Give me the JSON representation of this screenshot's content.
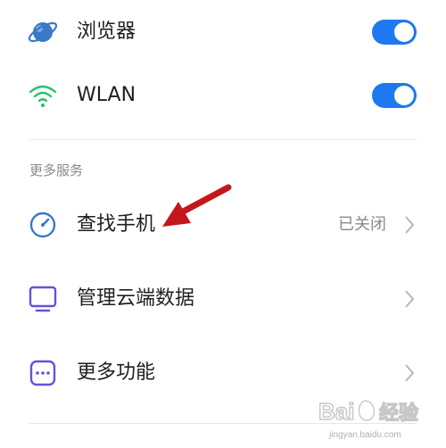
{
  "settings": {
    "browser": {
      "label": "浏览器",
      "icon": "planet-icon",
      "enabled": true
    },
    "wlan": {
      "label": "WLAN",
      "icon": "wifi-icon",
      "enabled": true
    }
  },
  "more_services": {
    "title": "更多服务",
    "items": [
      {
        "label": "查找手机",
        "icon": "gauge-icon",
        "status": "已关闭"
      },
      {
        "label": "管理云端数据",
        "icon": "monitor-icon"
      },
      {
        "label": "更多功能",
        "icon": "more-dots-icon"
      }
    ]
  },
  "colors": {
    "toggle_on": "#1e78f0",
    "icon_blue": "#3a78c9",
    "icon_purple": "#6b4fd8",
    "arrow_red": "#c3171b"
  },
  "watermark": {
    "text": "Bai 经验",
    "subtext": "jingyan.baidu.com"
  }
}
